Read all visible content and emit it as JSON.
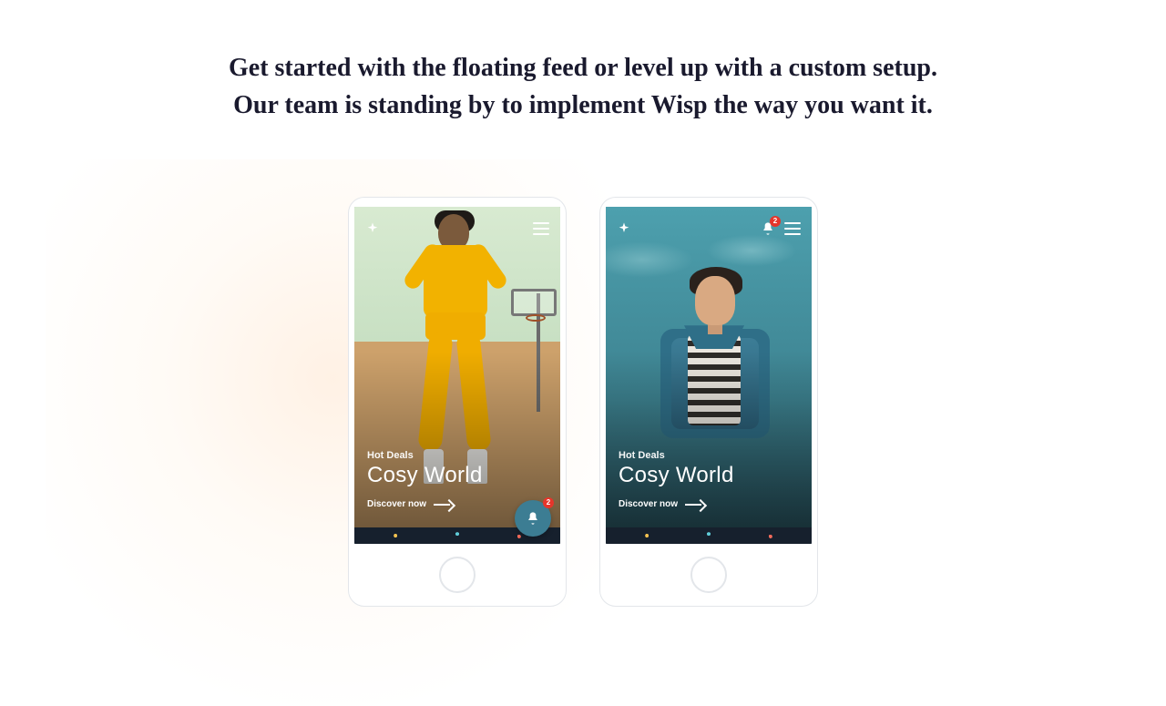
{
  "headline": {
    "line1": "Get started with the floating feed or level up with a custom setup.",
    "line2": "Our team is standing by to implement Wisp the way you want it."
  },
  "phones": {
    "left": {
      "subtitle": "Hot Deals",
      "title": "Cosy World",
      "cta": "Discover now",
      "fab_badge": "2"
    },
    "right": {
      "subtitle": "Hot Deals",
      "title": "Cosy World",
      "cta": "Discover now",
      "bell_badge": "2"
    }
  }
}
